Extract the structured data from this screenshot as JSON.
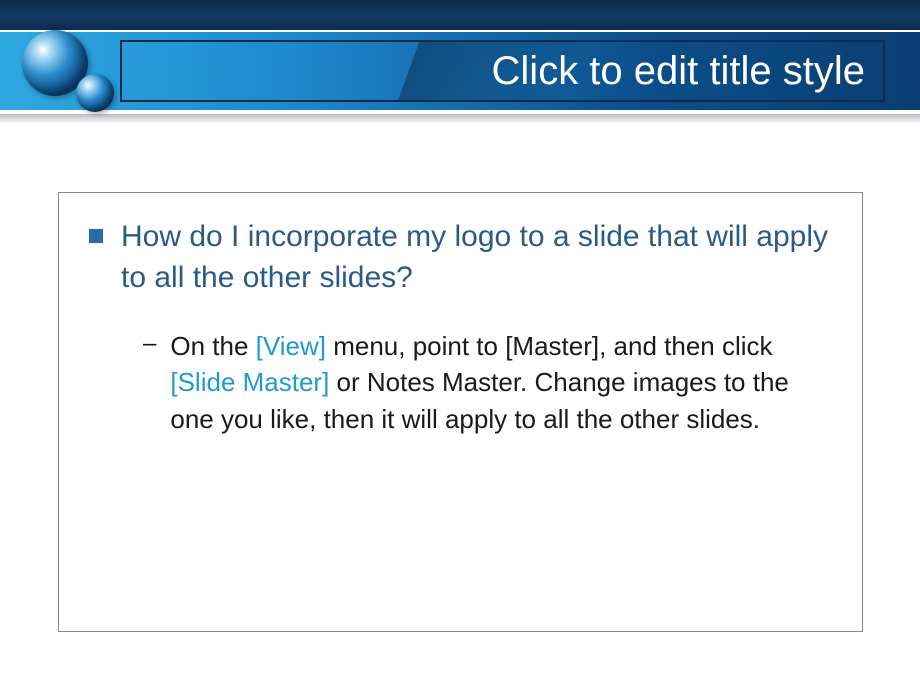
{
  "header": {
    "title": "Click to edit title style"
  },
  "content": {
    "question": "How do I incorporate my logo to a slide that will apply to all the other slides?",
    "answer": {
      "part1": "On the ",
      "link1": "[View]",
      "part2": " menu, point to [Master], and then click ",
      "link2": "[Slide Master]",
      "part3": " or Notes Master. Change images to the one you like, then it will apply to all the other slides."
    }
  }
}
